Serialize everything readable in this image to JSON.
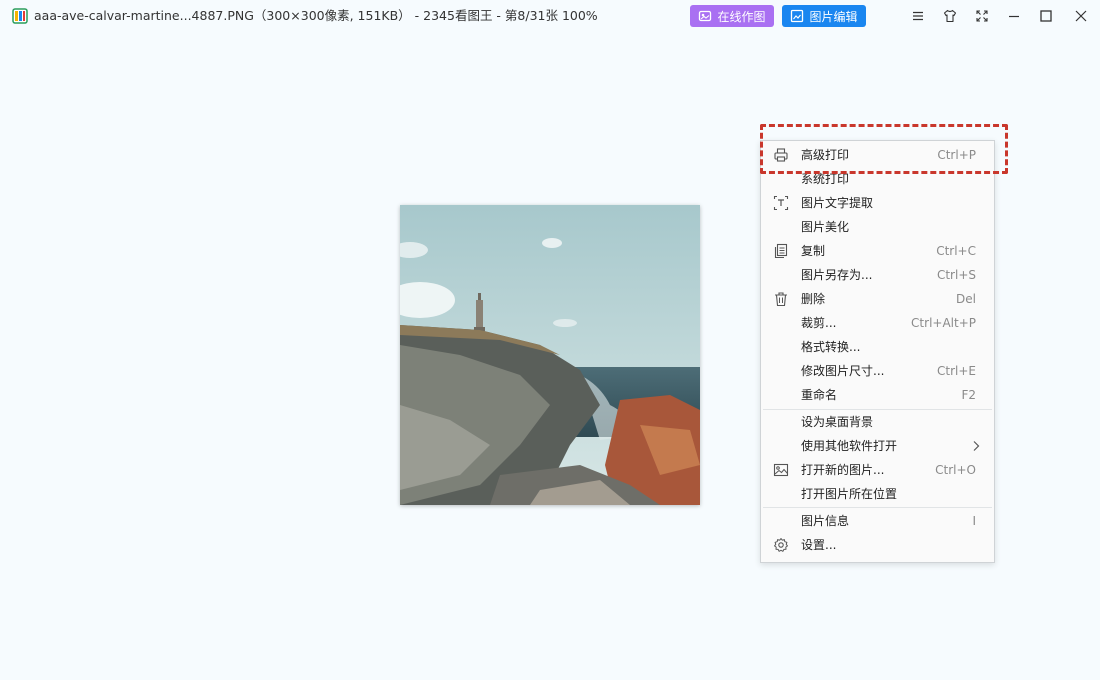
{
  "window": {
    "title": "aaa-ave-calvar-martine...4887.PNG（300×300像素, 151KB） - 2345看图王 - 第8/31张 100%"
  },
  "toolbar": {
    "online_label": "在线作图",
    "edit_label": "图片编辑"
  },
  "colors": {
    "online_button": "#a970f2",
    "edit_button": "#1a86f0",
    "highlight": "#c9372c"
  },
  "menu": {
    "items": [
      {
        "label": "高级打印",
        "shortcut": "Ctrl+P",
        "icon": "printer-icon"
      },
      {
        "label": "系统打印",
        "shortcut": ""
      },
      {
        "label": "图片文字提取",
        "shortcut": "",
        "icon": "text-extract-icon"
      },
      {
        "label": "图片美化",
        "shortcut": ""
      },
      {
        "label": "复制",
        "shortcut": "Ctrl+C",
        "icon": "copy-icon"
      },
      {
        "label": "图片另存为...",
        "shortcut": "Ctrl+S"
      },
      {
        "label": "删除",
        "shortcut": "Del",
        "icon": "trash-icon"
      },
      {
        "label": "裁剪...",
        "shortcut": "Ctrl+Alt+P"
      },
      {
        "label": "格式转换...",
        "shortcut": ""
      },
      {
        "label": "修改图片尺寸...",
        "shortcut": "Ctrl+E"
      },
      {
        "label": "重命名",
        "shortcut": "F2"
      },
      {
        "label": "设为桌面背景",
        "shortcut": ""
      },
      {
        "label": "使用其他软件打开",
        "shortcut": "",
        "icon": "chevron-right-icon"
      },
      {
        "label": "打开新的图片...",
        "shortcut": "Ctrl+O",
        "icon": "image-icon"
      },
      {
        "label": "打开图片所在位置",
        "shortcut": ""
      },
      {
        "label": "图片信息",
        "shortcut": "I"
      },
      {
        "label": "设置...",
        "shortcut": "",
        "icon": "gear-icon"
      }
    ]
  }
}
